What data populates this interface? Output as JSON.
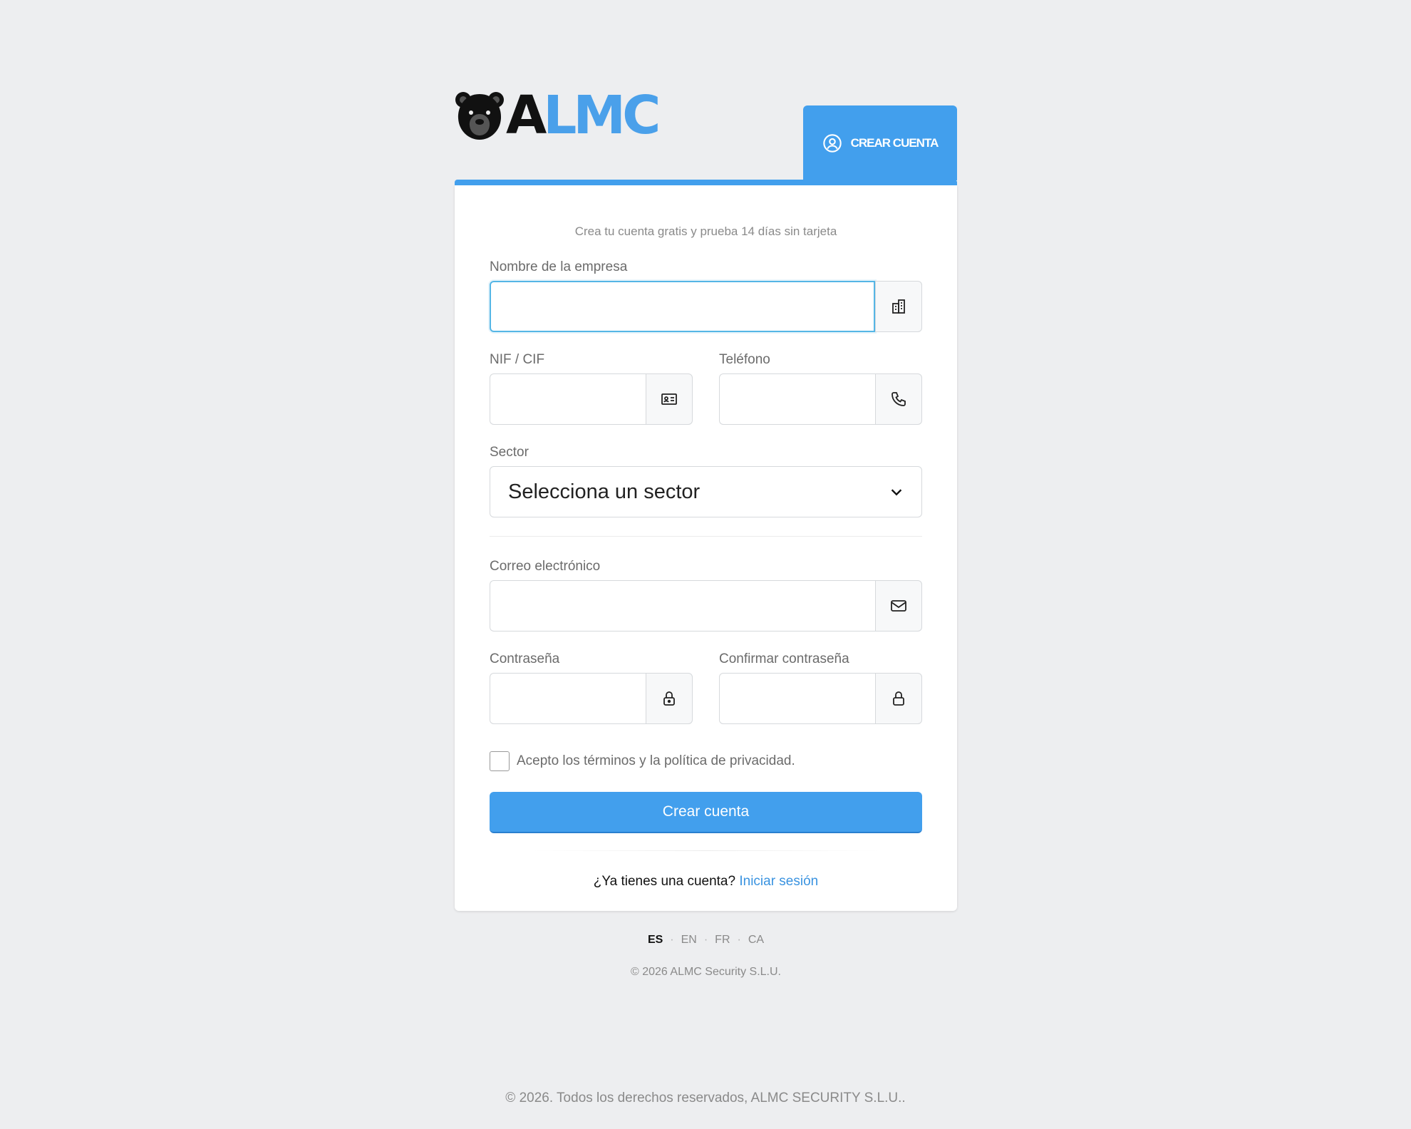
{
  "brand": {
    "name_part1": "A",
    "name_part2": "LMC"
  },
  "header": {
    "tab_label": "CREAR CUENTA"
  },
  "form": {
    "subtitle": "Crea tu cuenta gratis y prueba 14 días sin tarjeta",
    "company": {
      "label": "Nombre de la empresa",
      "value": ""
    },
    "nif": {
      "label": "NIF / CIF",
      "value": ""
    },
    "phone": {
      "label": "Teléfono",
      "value": ""
    },
    "sector": {
      "label": "Sector",
      "selected": "Selecciona un sector"
    },
    "email": {
      "label": "Correo electrónico",
      "value": ""
    },
    "password": {
      "label": "Contraseña",
      "value": ""
    },
    "confirm_password": {
      "label": "Confirmar contraseña",
      "value": ""
    },
    "terms_label": "Acepto los términos y la política de privacidad.",
    "submit_label": "Crear cuenta",
    "login_prompt": "¿Ya tienes una cuenta?",
    "login_link": "Iniciar sesión"
  },
  "languages": [
    "ES",
    "EN",
    "FR",
    "CA"
  ],
  "active_language": "ES",
  "footer": {
    "card_copyright": "© 2026 ALMC Security S.L.U.",
    "page_copyright": "© 2026. Todos los derechos reservados, ALMC SECURITY S.L.U.."
  },
  "colors": {
    "accent": "#429fed",
    "focus": "#55b6e6",
    "background": "#edeef0"
  }
}
